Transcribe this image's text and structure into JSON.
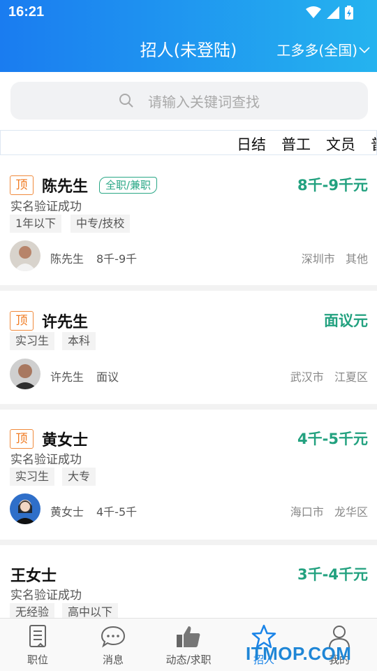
{
  "status_bar": {
    "time": "16:21"
  },
  "header": {
    "title": "招人(未登陆)",
    "city": "工多多(全国)"
  },
  "search": {
    "placeholder": "请输入关键词查找"
  },
  "tags": [
    "日结",
    "普工",
    "文员",
    "普"
  ],
  "cards": [
    {
      "top_label": "顶",
      "name": "陈先生",
      "job_type": "全职/兼职",
      "salary": "8千-9千元",
      "verified": "实名验证成功",
      "chips": [
        "1年以下",
        "中专/技校"
      ],
      "contact_name": "陈先生",
      "contact_salary": "8千-9千",
      "city": "深圳市",
      "district": "其他"
    },
    {
      "top_label": "顶",
      "name": "许先生",
      "salary": "面议元",
      "chips": [
        "实习生",
        "本科"
      ],
      "contact_name": "许先生",
      "contact_salary": "面议",
      "city": "武汉市",
      "district": "江夏区"
    },
    {
      "top_label": "顶",
      "name": "黄女士",
      "salary": "4千-5千元",
      "verified": "实名验证成功",
      "chips": [
        "实习生",
        "大专"
      ],
      "contact_name": "黄女士",
      "contact_salary": "4千-5千",
      "city": "海口市",
      "district": "龙华区"
    },
    {
      "name": "王女士",
      "salary": "3千-4千元",
      "verified": "实名验证成功",
      "chips": [
        "无经验",
        "高中以下"
      ]
    }
  ],
  "nav": [
    {
      "label": "职位",
      "icon": "document-icon"
    },
    {
      "label": "消息",
      "icon": "chat-bubble-icon"
    },
    {
      "label": "动态/求职",
      "icon": "thumbs-up-icon"
    },
    {
      "label": "招人",
      "icon": "star-icon",
      "active": true
    },
    {
      "label": "我的",
      "icon": "person-icon"
    }
  ],
  "watermark": "ITMOP.COM",
  "colors": {
    "header_start": "#1a7cf0",
    "header_end": "#25b3ef",
    "salary": "#22a17f",
    "badge": "#f07a20",
    "active_nav": "#1a84e8"
  }
}
